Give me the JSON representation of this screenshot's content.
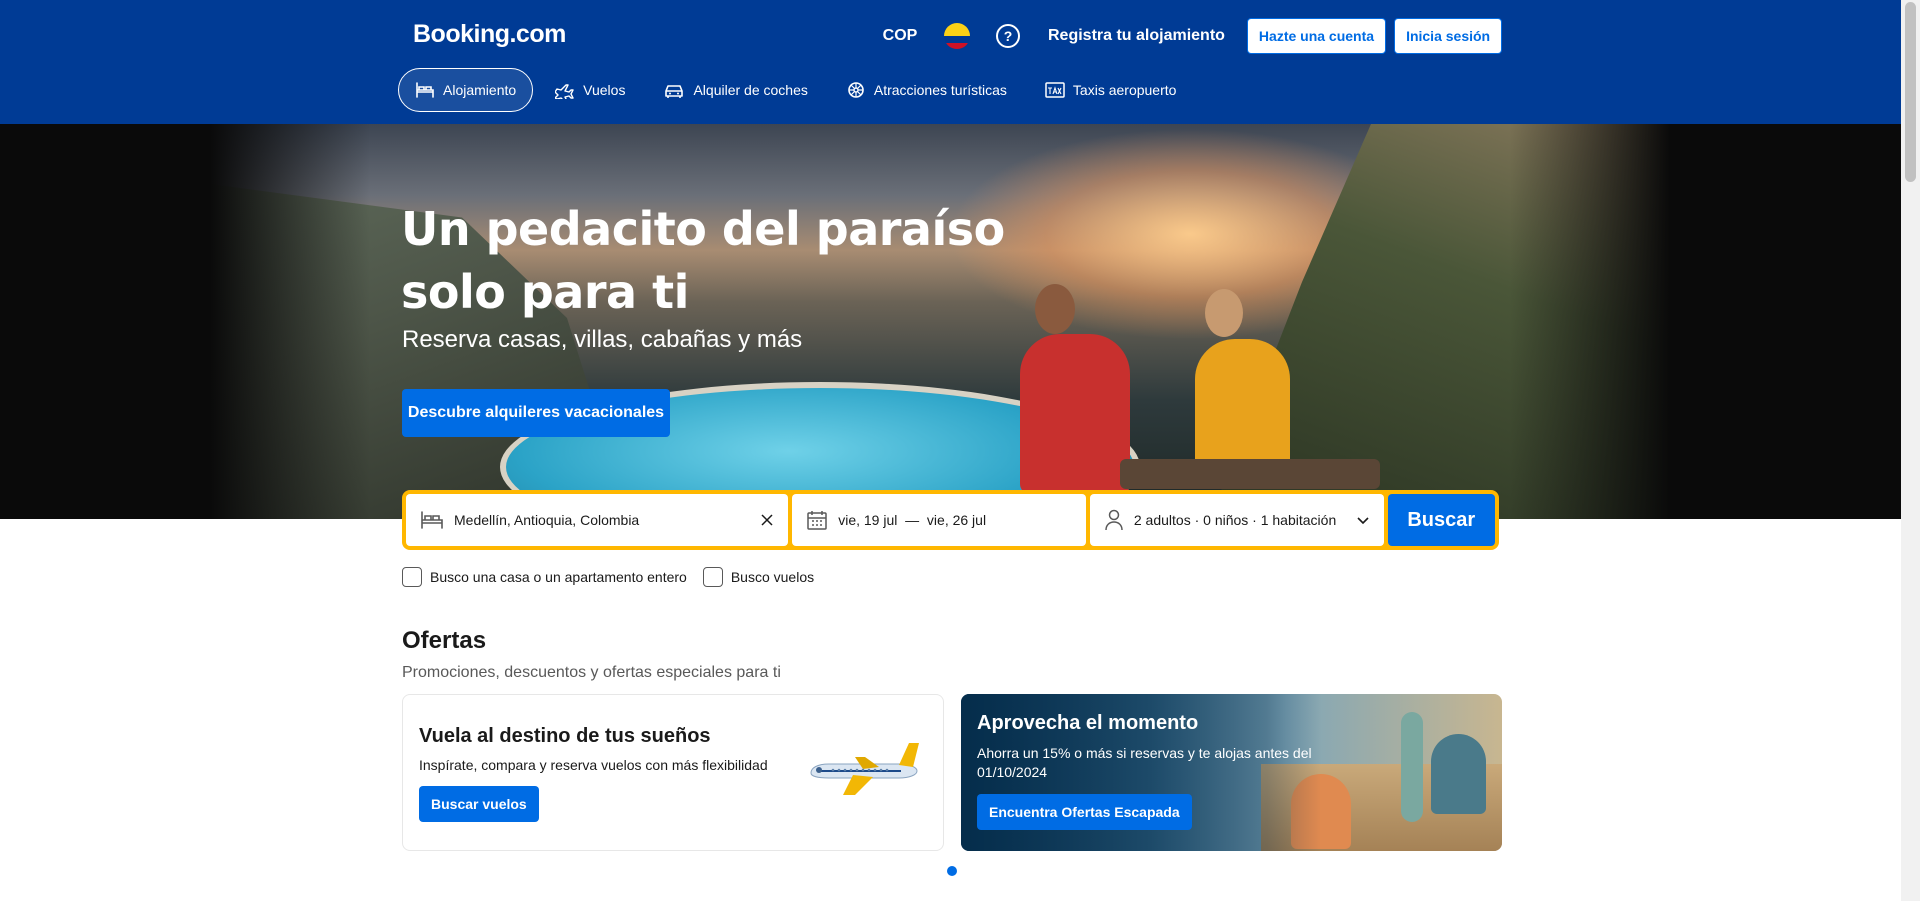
{
  "header": {
    "logo": "Booking.com",
    "currency": "COP",
    "help_symbol": "?",
    "register_property": "Registra tu alojamiento",
    "create_account": "Hazte una cuenta",
    "sign_in": "Inicia sesión"
  },
  "nav": {
    "items": [
      {
        "label": "Alojamiento",
        "icon": "bed-icon",
        "active": true
      },
      {
        "label": "Vuelos",
        "icon": "plane-icon"
      },
      {
        "label": "Alquiler de coches",
        "icon": "car-icon"
      },
      {
        "label": "Atracciones turísticas",
        "icon": "attractions-icon"
      },
      {
        "label": "Taxis aeropuerto",
        "icon": "taxi-icon"
      }
    ]
  },
  "hero": {
    "title": "Un pedacito del paraíso solo para ti",
    "subtitle": "Reserva casas, villas, cabañas y más",
    "button": "Descubre alquileres vacacionales"
  },
  "search": {
    "destination": "Medellín, Antioquia, Colombia",
    "dates": "vie, 19 jul  —  vie, 26 jul",
    "guests": "2 adultos · 0 niños · 1 habitación",
    "button": "Buscar"
  },
  "options": {
    "whole_home": "Busco una casa o un apartamento entero",
    "flights": "Busco vuelos"
  },
  "offers": {
    "title": "Ofertas",
    "subtitle": "Promociones, descuentos y ofertas especiales para ti",
    "card1": {
      "title": "Vuela al destino de tus sueños",
      "text": "Inspírate, compara y reserva vuelos con más flexibilidad",
      "button": "Buscar vuelos"
    },
    "card2": {
      "title": "Aprovecha el momento",
      "text": "Ahorra un 15% o más si reservas y te alojas antes del 01/10/2024",
      "button": "Encuentra Ofertas Escapada"
    }
  },
  "colors": {
    "brand": "#003b95",
    "primary": "#006ce4",
    "search_border": "#ffb700"
  }
}
